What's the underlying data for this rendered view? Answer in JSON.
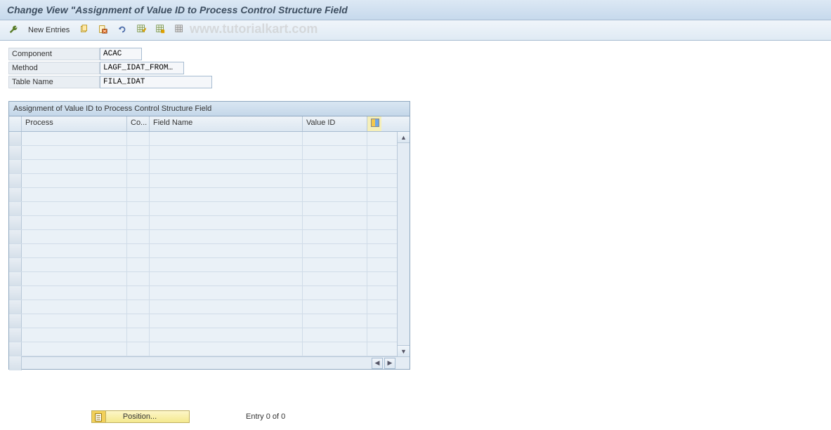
{
  "header": {
    "title": "Change View \"Assignment of Value ID to Process Control Structure Field"
  },
  "toolbar": {
    "new_entries_label": "New Entries",
    "watermark": "www.tutorialkart.com"
  },
  "form": {
    "component_label": "Component",
    "component_value": "ACAC",
    "method_label": "Method",
    "method_value": "LAGF_IDAT_FROM…",
    "table_label": "Table Name",
    "table_value": "FILA_IDAT"
  },
  "grid": {
    "title": "Assignment of Value ID to Process Control Structure Field",
    "columns": {
      "process": "Process",
      "co": "Co...",
      "field_name": "Field Name",
      "value_id": "Value ID"
    },
    "row_count": 16
  },
  "footer": {
    "position_label": "Position...",
    "entry_text": "Entry 0 of 0"
  }
}
